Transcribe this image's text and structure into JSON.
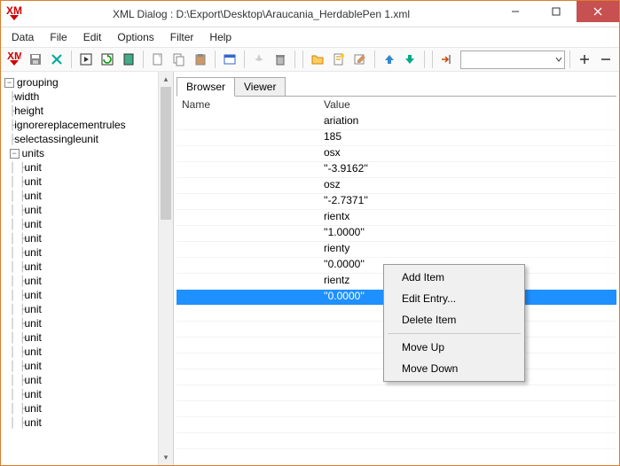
{
  "window": {
    "title": "XML Dialog : D:\\Export\\Desktop\\Araucania_HerdablePen 1.xml"
  },
  "menu": {
    "data": "Data",
    "file": "File",
    "edit": "Edit",
    "options": "Options",
    "filter": "Filter",
    "help": "Help"
  },
  "tree": {
    "root": "grouping",
    "children": [
      "width",
      "height",
      "ignorereplacementrules",
      "selectassingleunit"
    ],
    "unitsLabel": "units",
    "unit": "unit",
    "unitCount": 19
  },
  "tabs": {
    "browser": "Browser",
    "viewer": "Viewer"
  },
  "grid": {
    "headers": {
      "name": "Name",
      "value": "Value"
    },
    "rows": [
      {
        "name": "",
        "value": "ariation"
      },
      {
        "name": "",
        "value": "185"
      },
      {
        "name": "",
        "value": "osx"
      },
      {
        "name": "",
        "value": "''-3.9162''"
      },
      {
        "name": "",
        "value": "osz"
      },
      {
        "name": "",
        "value": "''-2.7371''"
      },
      {
        "name": "",
        "value": "rientx"
      },
      {
        "name": "",
        "value": "''1.0000''"
      },
      {
        "name": "",
        "value": "rienty"
      },
      {
        "name": "",
        "value": "''0.0000''"
      },
      {
        "name": "",
        "value": "rientz"
      },
      {
        "name": "",
        "value": "''0.0000''"
      }
    ],
    "selectedIndex": 11
  },
  "context": {
    "addItem": "Add Item",
    "editEntry": "Edit Entry...",
    "deleteItem": "Delete Item",
    "moveUp": "Move Up",
    "moveDown": "Move Down"
  }
}
